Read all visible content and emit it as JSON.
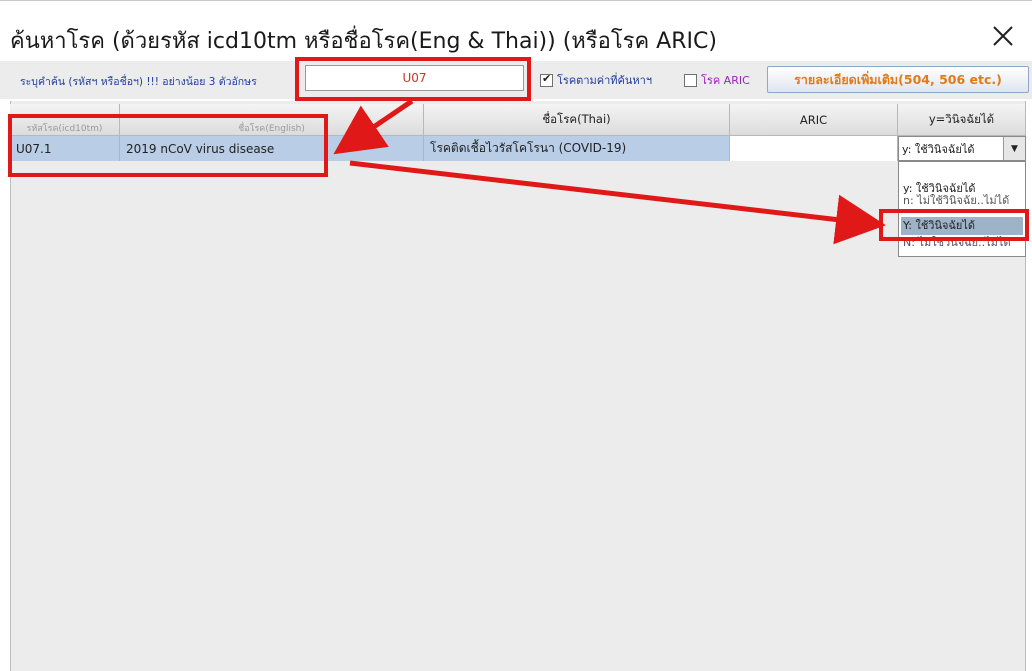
{
  "window": {
    "title": "ค้นหาโรค (ด้วยรหัส icd10tm หรือชื่อโรค(Eng & Thai)) (หรือโรค ARIC)",
    "close_glyph": "✕"
  },
  "search": {
    "label": "ระบุคำค้น (รหัสฯ หรือชื่อฯ) !!! อย่างน้อย 3 ตัวอักษร",
    "value": "U07",
    "checkbox_filter_label": "โรคตามค่าที่ค้นหาฯ",
    "checkbox_filter_checked": true,
    "checkbox_aric_label": "โรค ARIC",
    "checkbox_aric_checked": false,
    "details_button": "รายละเอียดเพิ่มเติม(504, 506 etc.)"
  },
  "table": {
    "columns": [
      "รหัสโรค(icd10tm)",
      "ชื่อโรค(English)",
      "ชื่อโรค(Thai)",
      "ARIC",
      "y=วินิจฉัยได้"
    ],
    "rows": [
      {
        "code": "U07.1",
        "name_en": "2019 nCoV virus disease",
        "name_th": "โรคติดเชื้อไวรัสโคโรนา (COVID-19)",
        "aric": "",
        "diagnosis": "y: ใช้วินิจฉัยได้"
      }
    ]
  },
  "dropdown": {
    "options": [
      "y: ใช้วินิจฉัยได้",
      "n: ไม่ใช้วินิจฉัย..ไม่ได้",
      "Y: ใช้วินิจฉัยได้",
      "N: ไม่ใช้วินิจฉัย..ไม่ได้"
    ],
    "highlighted_index": 2
  },
  "colors": {
    "annotation": "#e01818",
    "selection": "#b9cde6",
    "details_text": "#e07b1a",
    "label_text": "#1f3d9a"
  },
  "icons": [
    "close-icon",
    "chevron-down-icon",
    "checkbox-icon"
  ]
}
